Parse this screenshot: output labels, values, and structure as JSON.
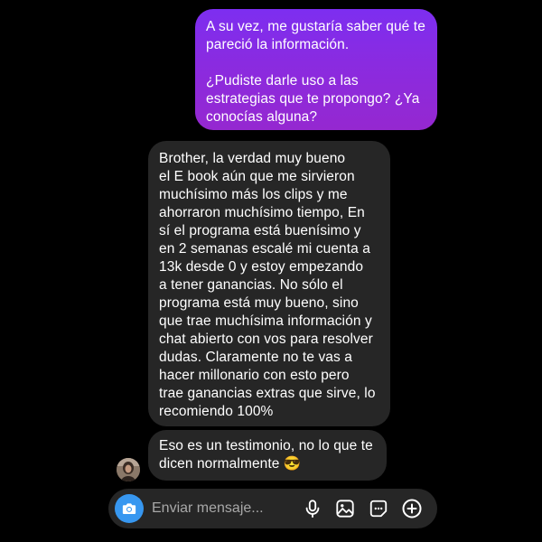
{
  "conversation": {
    "sent_message": {
      "paragraph_1": "A su vez, me gustaría saber qué te pareció la información.",
      "paragraph_2": "¿Pudiste darle uso a las estrategias que te propongo? ¿Ya conocías alguna?"
    },
    "received_messages": [
      {
        "text": "Brother, la verdad muy bueno\nel E book aún que me sirvieron\nmuchísimo más los clips y me\nahorraron muchísimo tiempo, En\nsí el programa está buenísimo y\nen 2 semanas escalé mi cuenta a\n13k desde 0 y estoy empezando\na tener ganancias. No sólo el\nprograma está muy bueno, sino\nque trae muchísima información y\nchat abierto con vos para resolver\ndudas. Claramente no te vas a\nhacer millonario con esto pero\ntrae ganancias extras que sirve, lo\nrecomiendo 100%"
      },
      {
        "text": "Eso es un testimonio, no lo que te\ndicen normalmente 😎"
      }
    ]
  },
  "composer": {
    "placeholder": "Enviar mensaje...",
    "value": ""
  },
  "icons": {
    "camera": "camera-icon",
    "microphone": "microphone-icon",
    "gallery": "gallery-icon",
    "sticker": "sticker-icon",
    "add": "plus-circle-icon"
  },
  "colors": {
    "background": "#000000",
    "sent_bubble_gradient": [
      "#7d2ef0",
      "#9528d0"
    ],
    "received_bubble": "#262626",
    "camera_button": "#3797f0",
    "text": "#ffffff",
    "placeholder": "#a8a8a8"
  }
}
